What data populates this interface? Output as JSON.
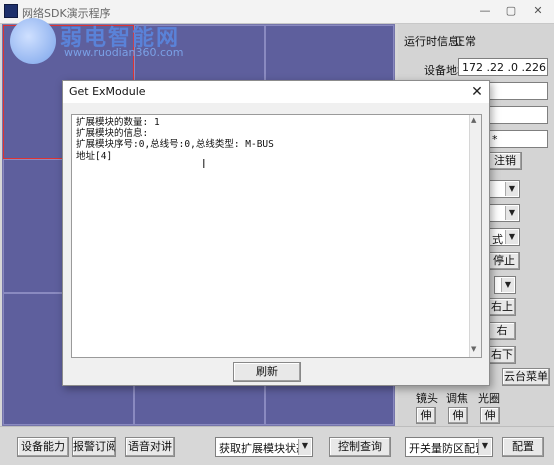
{
  "window": {
    "title": "网络SDK演示程序",
    "minimize": "—",
    "maximize": "▢",
    "close": "✕"
  },
  "watermark": {
    "text": "弱电智能网",
    "url": "www.ruodian360.com"
  },
  "right_panel": {
    "status_label": "运行时信息:",
    "status_value": "正常",
    "device_addr_label": "设备地址:",
    "device_addr_value": "172 .22 .0 .226",
    "field2": "",
    "field3": "",
    "field4": "*",
    "logout_button": "注销",
    "combo1": "",
    "combo2": "",
    "combo3": "式",
    "stop_button": "停止",
    "combo4": "",
    "ptz_upright": "右上",
    "ptz_right": "右",
    "ptz_downright": "右下",
    "ptz_menu": "云台菜单",
    "lens_label": "镜头",
    "focus_label": "调焦",
    "iris_label": "光圈",
    "stretch1": "伸",
    "stretch2": "伸",
    "stretch3": "伸"
  },
  "bottom_bar": {
    "device_capability": "设备能力",
    "alarm_subscribe": "报警订阅",
    "voice_talk": "语音对讲",
    "ex_module_combo": "获取扩展模块状态",
    "control_query": "控制查询",
    "zone_config_combo": "开关量防区配置",
    "config_button": "配置"
  },
  "dialog": {
    "title": "Get ExModule",
    "close": "✕",
    "lines": [
      "扩展模块的数量: 1",
      "扩展模块的信息:",
      "扩展模块序号:0,总线号:0,总线类型: M-BUS",
      "地址[4]"
    ],
    "cursor": "I",
    "refresh_button": "刷新"
  }
}
